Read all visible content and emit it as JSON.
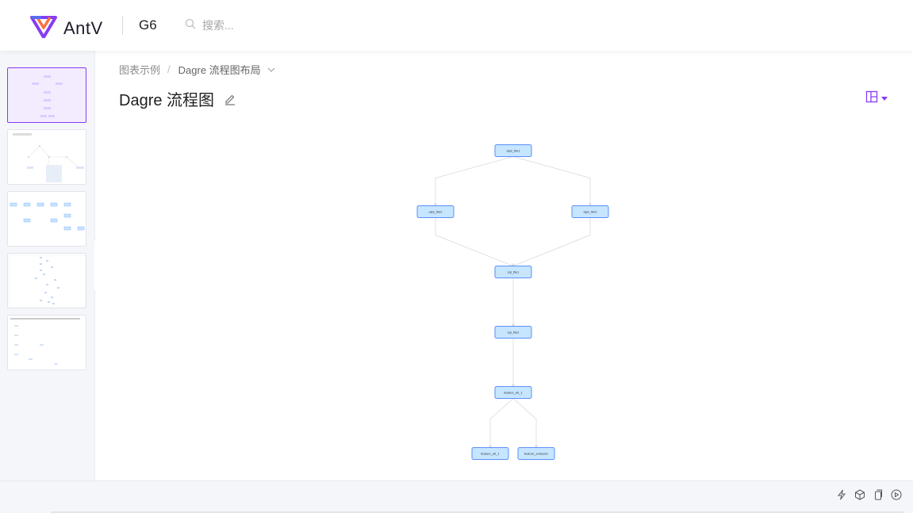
{
  "header": {
    "brand": "AntV",
    "product": "G6",
    "search_placeholder": "搜索...",
    "logo_icon": "antv-logo-icon",
    "search_icon": "search-icon"
  },
  "sidebar": {
    "thumbnails": [
      {
        "name": "thumb-dagre-flow",
        "active": true
      },
      {
        "name": "thumb-2",
        "active": false
      },
      {
        "name": "thumb-3",
        "active": false
      },
      {
        "name": "thumb-4",
        "active": false
      },
      {
        "name": "thumb-5",
        "active": false
      }
    ],
    "collapse_icon": "chevron-left-icon"
  },
  "breadcrumb": {
    "parent": "图表示例",
    "separator": "/",
    "current": "Dagre 流程图布局"
  },
  "page": {
    "title": "Dagre 流程图",
    "edit_icon": "edit-icon",
    "layout_icon": "layout-icon"
  },
  "graph": {
    "nodes": [
      {
        "id": "n1",
        "label": "alps_file1"
      },
      {
        "id": "n2",
        "label": "alps_file2"
      },
      {
        "id": "n3",
        "label": "alps_file3"
      },
      {
        "id": "n4",
        "label": "sql_file1"
      },
      {
        "id": "n5",
        "label": "sql_file2"
      },
      {
        "id": "n6",
        "label": "feature_etl_1"
      },
      {
        "id": "n7",
        "label": "feature_etl_1"
      },
      {
        "id": "n8",
        "label": "feature_extractor"
      }
    ],
    "edges": [
      [
        "n1",
        "n2"
      ],
      [
        "n1",
        "n3"
      ],
      [
        "n2",
        "n4"
      ],
      [
        "n3",
        "n4"
      ],
      [
        "n4",
        "n5"
      ],
      [
        "n5",
        "n6"
      ],
      [
        "n6",
        "n7"
      ],
      [
        "n6",
        "n8"
      ]
    ],
    "colors": {
      "fill": "#c6e5ff",
      "stroke": "#5b8ff9",
      "edge": "#e2e2e2"
    }
  },
  "footer": {
    "tools": [
      "lightning-icon",
      "codesandbox-icon",
      "copy-icon",
      "play-icon"
    ]
  },
  "colors": {
    "accent": "#873bf4",
    "sidebar_bg": "#f5f6fa"
  }
}
